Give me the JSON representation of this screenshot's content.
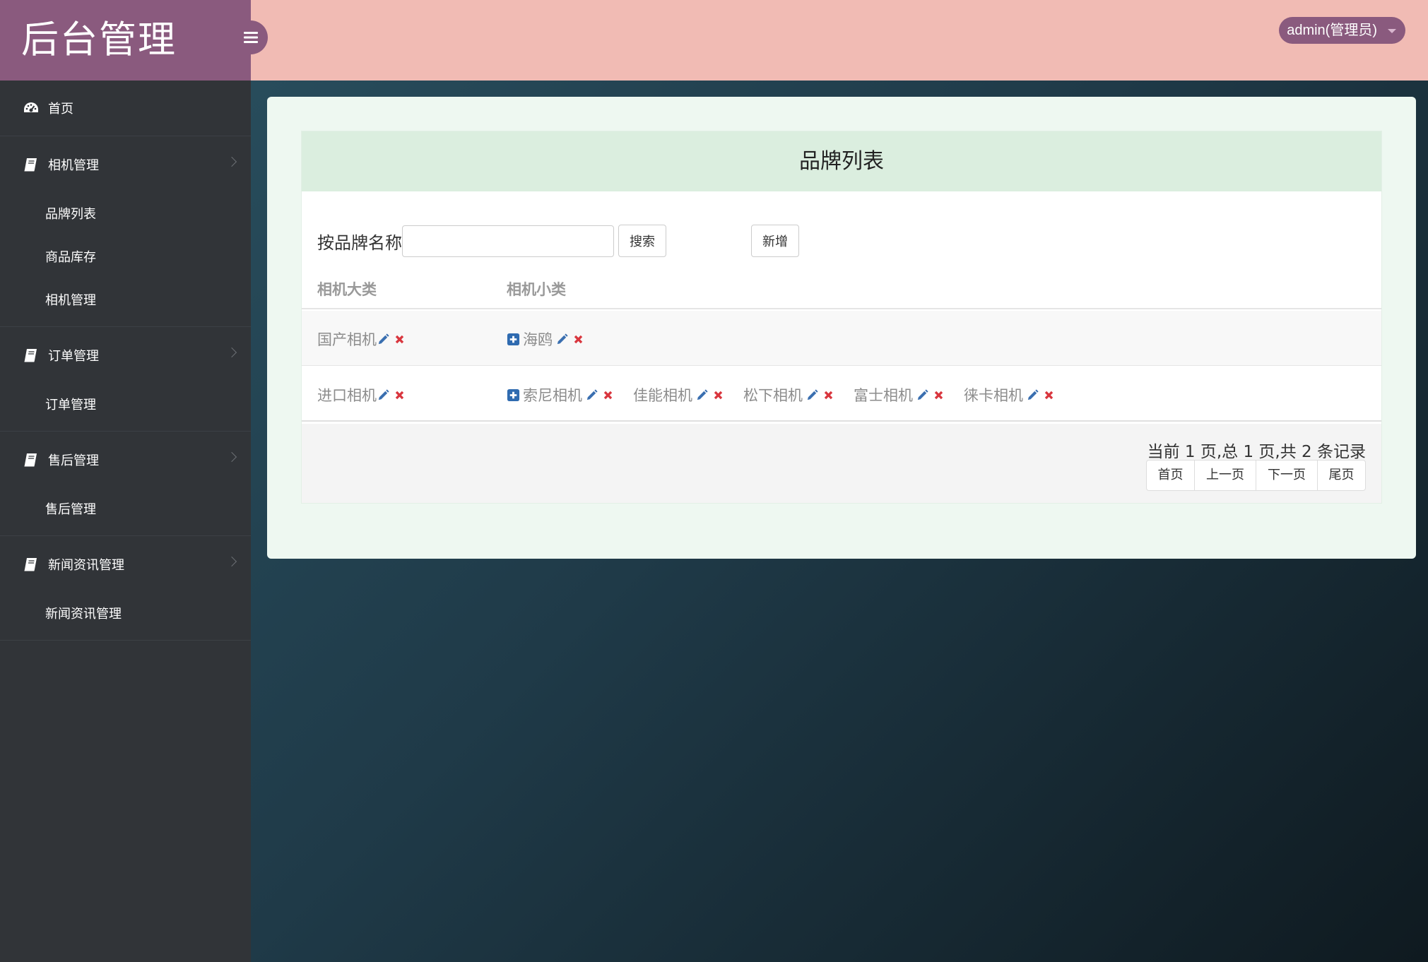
{
  "app": {
    "title": "后台管理"
  },
  "header": {
    "user": "admin(管理员)"
  },
  "sidebar": {
    "home": "首页",
    "groups": [
      {
        "label": "相机管理",
        "items": [
          "品牌列表",
          "商品库存",
          "相机管理"
        ]
      },
      {
        "label": "订单管理",
        "items": [
          "订单管理"
        ]
      },
      {
        "label": "售后管理",
        "items": [
          "售后管理"
        ]
      },
      {
        "label": "新闻资讯管理",
        "items": [
          "新闻资讯管理"
        ]
      }
    ]
  },
  "main": {
    "panel_title": "品牌列表",
    "search": {
      "label": "按品牌名称",
      "value": "",
      "search_button": "搜索",
      "add_button": "新增"
    },
    "table": {
      "headers": [
        "相机大类",
        "相机小类"
      ],
      "rows": [
        {
          "category": "国产相机",
          "brands": [
            "海鸥"
          ]
        },
        {
          "category": "进口相机",
          "brands": [
            "索尼相机",
            "佳能相机",
            "松下相机",
            "富士相机",
            "徕卡相机"
          ]
        }
      ]
    },
    "pagination": {
      "info": "当前 1 页,总 1 页,共 2 条记录",
      "buttons": [
        "首页",
        "上一页",
        "下一页",
        "尾页"
      ]
    }
  },
  "colors": {
    "sidebar_bg": "#313438",
    "logo_bg": "#8a5a7e",
    "topbar_bg": "#f1bbb4",
    "panel_head_bg": "#dbeedf",
    "edit_icon": "#3a6fb0",
    "delete_icon": "#d9363e"
  }
}
